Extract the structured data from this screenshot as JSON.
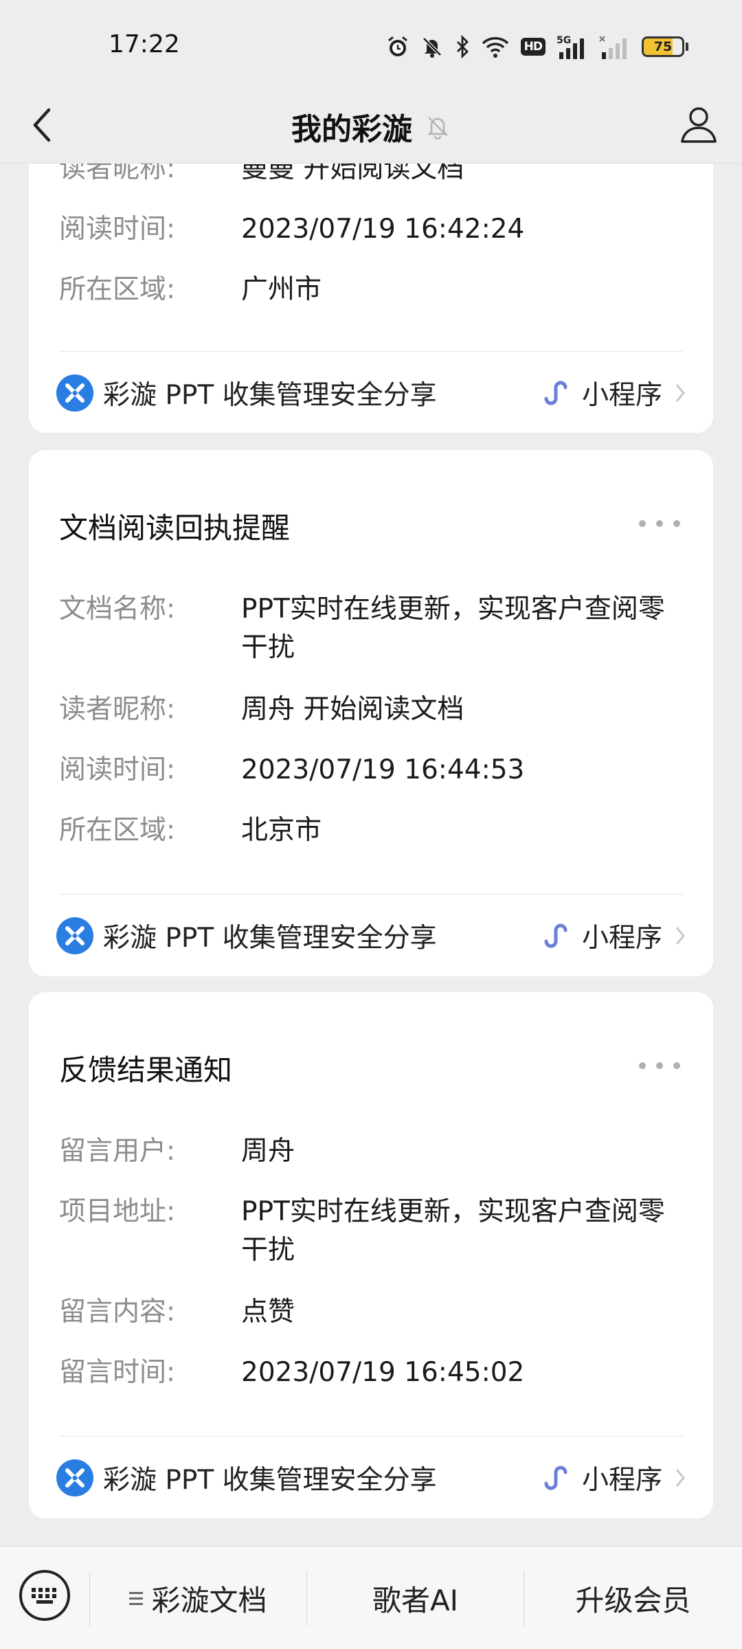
{
  "status_bar": {
    "time": "17:22",
    "network": "5G",
    "hd_badge": "HD",
    "battery_level": "75",
    "battery_fraction": 0.75,
    "icons": [
      "alarm-icon",
      "mute-icon",
      "bluetooth-icon",
      "wifi-icon",
      "hd-badge",
      "signal-5g-icon",
      "signal-icon",
      "battery-icon"
    ]
  },
  "nav": {
    "title": "我的彩漩",
    "back_icon": "chevron-left-icon",
    "mute_icon": "bell-off-icon",
    "profile_icon": "user-icon"
  },
  "cards": [
    {
      "title": "",
      "rows": [
        {
          "label": "读者昵称:",
          "value": "曼曼 开始阅读文档"
        },
        {
          "label": "阅读时间:",
          "value": "2023/07/19 16:42:24"
        },
        {
          "label": "所在区域:",
          "value": "广州市"
        }
      ],
      "footer": {
        "app_name": "彩漩 PPT 收集管理安全分享",
        "mini_label": "小程序"
      }
    },
    {
      "title": "文档阅读回执提醒",
      "rows": [
        {
          "label": "文档名称:",
          "value": "PPT实时在线更新，实现客户查阅零干扰"
        },
        {
          "label": "读者昵称:",
          "value": "周舟 开始阅读文档"
        },
        {
          "label": "阅读时间:",
          "value": "2023/07/19 16:44:53"
        },
        {
          "label": "所在区域:",
          "value": "北京市"
        }
      ],
      "footer": {
        "app_name": "彩漩 PPT 收集管理安全分享",
        "mini_label": "小程序"
      }
    },
    {
      "title": "反馈结果通知",
      "rows": [
        {
          "label": "留言用户:",
          "value": "周舟"
        },
        {
          "label": "项目地址:",
          "value": "PPT实时在线更新，实现客户查阅零干扰"
        },
        {
          "label": "留言内容:",
          "value": "点赞"
        },
        {
          "label": "留言时间:",
          "value": "2023/07/19 16:45:02"
        }
      ],
      "footer": {
        "app_name": "彩漩 PPT 收集管理安全分享",
        "mini_label": "小程序"
      }
    }
  ],
  "bottom_menu": {
    "keyboard_icon": "keyboard-icon",
    "items": [
      {
        "label": "彩漩文档",
        "icon": "menu-icon"
      },
      {
        "label": "歌者AI"
      },
      {
        "label": "升级会员"
      }
    ]
  },
  "colors": {
    "background": "#ededed",
    "card": "#ffffff",
    "logo_blue": "#2a7de1",
    "mini_program": "#6b7fd7",
    "label_gray": "#8c8c8c",
    "battery": "#f2c232"
  }
}
